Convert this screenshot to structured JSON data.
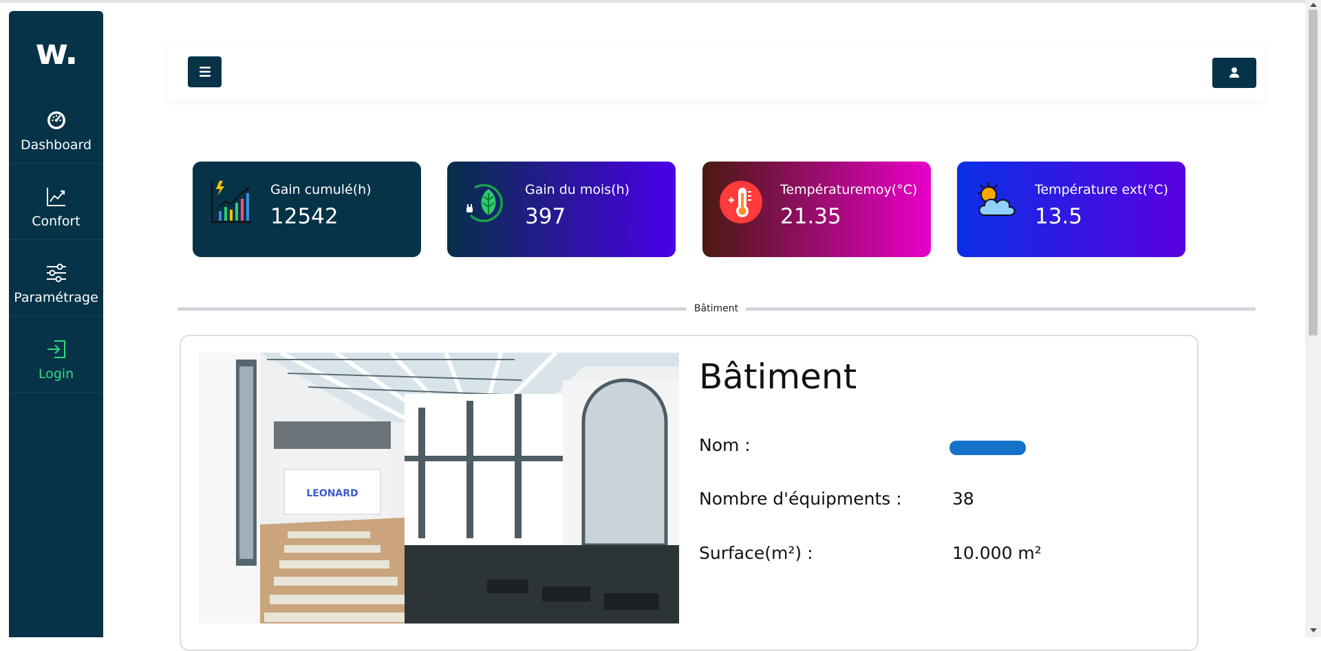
{
  "sidebar": {
    "logo": "w.",
    "items": [
      {
        "label": "Dashboard",
        "icon": "dashboard-gauge-icon"
      },
      {
        "label": "Confort",
        "icon": "chart-line-icon"
      },
      {
        "label": "Paramétrage",
        "icon": "sliders-icon"
      },
      {
        "label": "Login",
        "icon": "login-icon"
      }
    ]
  },
  "header": {
    "menu_icon": "hamburger-icon",
    "user_icon": "user-icon"
  },
  "cards": [
    {
      "title": "Gain cumulé(h)",
      "value": "12542",
      "icon": "energy-growth-chart-icon"
    },
    {
      "title": "Gain du mois(h)",
      "value": "397",
      "icon": "eco-leaf-plug-icon"
    },
    {
      "title": "Températuremoy(°C)",
      "value": "21.35",
      "icon": "thermometer-icon"
    },
    {
      "title": "Température ext(°C)",
      "value": "13.5",
      "icon": "sun-cloud-icon"
    }
  ],
  "divider_label": "Bâtiment",
  "building": {
    "title": "Bâtiment",
    "photo_sign": "LEONARD",
    "rows": [
      {
        "label": "Nom :",
        "value": ""
      },
      {
        "label": "Nombre d'équipments :",
        "value": "38"
      },
      {
        "label": "Surface(m²) :",
        "value": "10.000 m²"
      }
    ]
  },
  "colors": {
    "sidebar": "#063348",
    "accent_login": "#2ee07c",
    "redaction": "#1473c8"
  }
}
